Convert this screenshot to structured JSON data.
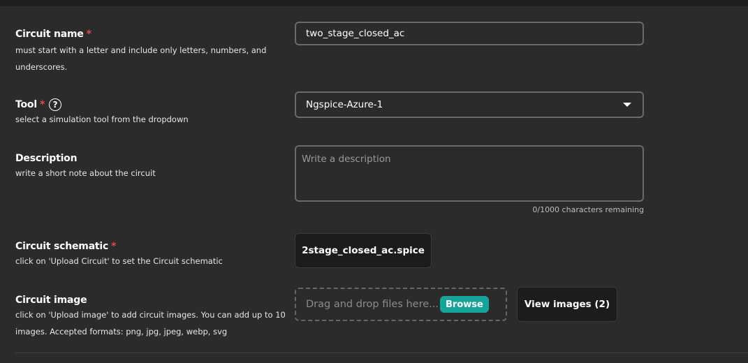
{
  "circuit_name": {
    "label": "Circuit name",
    "required_mark": "*",
    "description": "must start with a letter and include only letters, numbers, and underscores.",
    "value": "two_stage_closed_ac"
  },
  "tool": {
    "label": "Tool",
    "required_mark": "*",
    "help_icon_glyph": "?",
    "description": "select a simulation tool from the dropdown",
    "selected": "Ngspice-Azure-1"
  },
  "description_field": {
    "label": "Description",
    "description": "write a short note about the circuit",
    "placeholder": "Write a description",
    "char_count": "0/1000 characters remaining"
  },
  "circuit_schematic": {
    "label": "Circuit schematic",
    "required_mark": "*",
    "description": "click on 'Upload Circuit' to set the Circuit schematic",
    "file_button": "2stage_closed_ac.spice"
  },
  "circuit_image": {
    "label": "Circuit image",
    "description": "click on 'Upload image' to add circuit images. You can add up to 10 images. Accepted formats: png, jpg, jpeg, webp, svg",
    "dropzone_text": "Drag and drop files here...",
    "browse_label": "Browse",
    "view_images_label": "View images (2)"
  },
  "colors": {
    "background": "#2b2b2b",
    "required": "#e5484d",
    "accent": "#16a39a"
  }
}
